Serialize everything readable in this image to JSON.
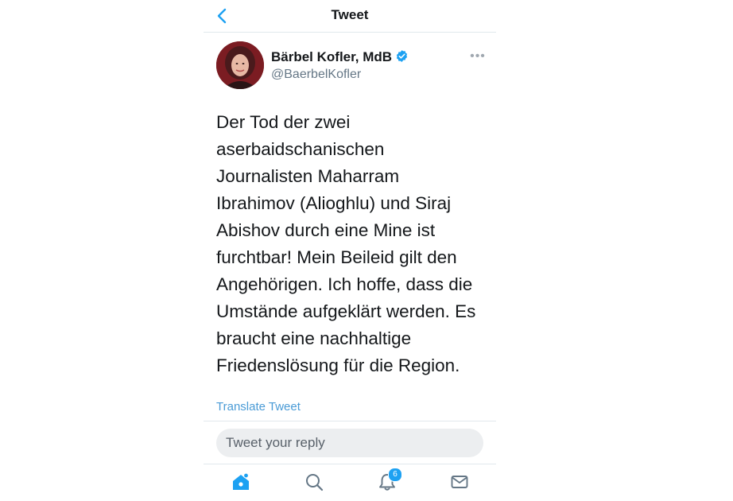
{
  "header": {
    "title": "Tweet"
  },
  "author": {
    "display_name": "Bärbel Kofler, MdB",
    "handle": "@BaerbelKofler"
  },
  "tweet": {
    "lines": [
      "Der Tod der zwei",
      "aserbaidschanischen",
      "Journalisten Maharram",
      "Ibrahimov (Alioghlu) und Siraj",
      "Abishov durch eine Mine ist",
      "furchtbar! Mein Beileid gilt den",
      "Angehörigen. Ich hoffe, dass die",
      "Umstände aufgeklärt werden. Es",
      "braucht eine nachhaltige",
      "Friedenslösung für die Region."
    ],
    "translate_label": "Translate Tweet"
  },
  "reply": {
    "placeholder": "Tweet your reply"
  },
  "tabbar": {
    "notifications_badge": "6"
  },
  "colors": {
    "accent": "#1da1f2",
    "link": "#4a9bd6",
    "icon_gray": "#657786"
  },
  "icons": [
    "back-chevron-icon",
    "verified-badge-icon",
    "more-options-icon",
    "home-icon",
    "search-icon",
    "bell-icon",
    "mail-icon"
  ]
}
